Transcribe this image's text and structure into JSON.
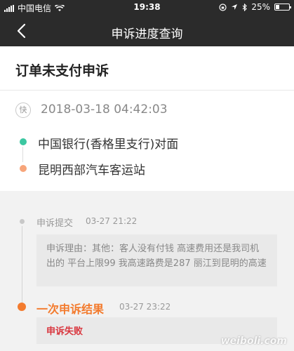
{
  "status_bar": {
    "carrier": "中国电信",
    "time": "19:38",
    "battery": "25%",
    "battery_level": 0.25,
    "icons": [
      "signal-icon",
      "wifi-icon",
      "orientation-lock-icon",
      "location-icon",
      "bluetooth-icon",
      "battery-icon"
    ]
  },
  "nav": {
    "title": "申诉进度查询",
    "back_icon": "chevron-left-icon"
  },
  "order": {
    "title": "订单未支付申诉",
    "type_badge": "快",
    "datetime": "2018-03-18 04:42:03",
    "start_location": "中国银行(香格里支行)对面",
    "end_location": "昆明西部汽车客运站",
    "start_color": "#3cc7a1",
    "end_color": "#f7a57a"
  },
  "timeline": {
    "steps": [
      {
        "label": "申诉提交",
        "time": "03-27 21:22",
        "content": "申诉理由：其他：客人没有付钱 高速费用还是我司机出的 平台上限99 我高速路费是287 丽江到昆明的高速"
      },
      {
        "label": "一次申诉结果",
        "time": "03-27 23:22",
        "content": "申诉失败"
      }
    ],
    "active_color": "#f37b2e",
    "fail_color": "#d9363e"
  },
  "watermark": "weiboli.com"
}
